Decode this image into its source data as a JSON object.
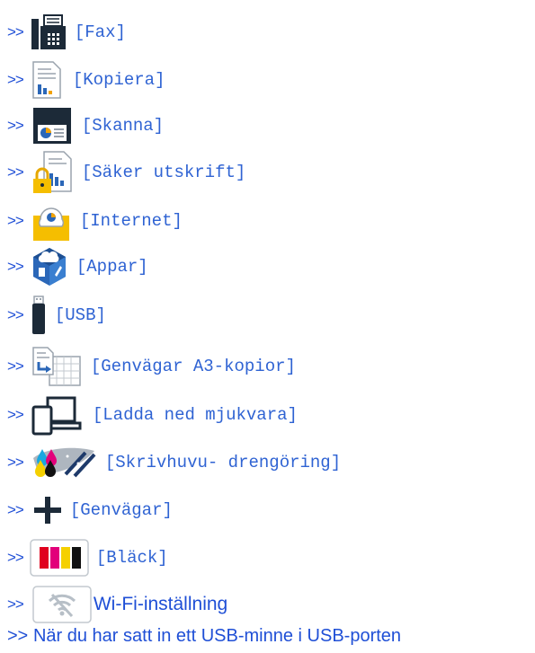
{
  "items": [
    {
      "arrow": ">>",
      "icon": "fax-icon",
      "label": "[Fax]"
    },
    {
      "arrow": ">>",
      "icon": "copy-icon",
      "label": "[Kopiera]"
    },
    {
      "arrow": ">>",
      "icon": "scan-icon",
      "label": "[Skanna]"
    },
    {
      "arrow": ">>",
      "icon": "secure-print-icon",
      "label": "[Säker utskrift]"
    },
    {
      "arrow": ">>",
      "icon": "internet-icon",
      "label": "[Internet]"
    },
    {
      "arrow": ">>",
      "icon": "apps-icon",
      "label": "[Appar]"
    },
    {
      "arrow": ">>",
      "icon": "usb-icon",
      "label": "[USB]"
    },
    {
      "arrow": ">>",
      "icon": "a3-copy-shortcuts-icon",
      "label": "[Genvägar A3-kopior]"
    },
    {
      "arrow": ">>",
      "icon": "download-software-icon",
      "label": "[Ladda ned mjukvara]"
    },
    {
      "arrow": ">>",
      "icon": "printhead-cleaning-icon",
      "label": "[Skrivhuvu- drengöring]"
    },
    {
      "arrow": ">>",
      "icon": "plus-icon",
      "label": "[Genvägar]"
    },
    {
      "arrow": ">>",
      "icon": "ink-icon",
      "label": "[Bläck]"
    },
    {
      "arrow": ">>",
      "icon": "wifi-off-icon",
      "label": "Wi-Fi-inställning"
    },
    {
      "arrow": ">>",
      "label": "När du har satt in ett USB-minne i USB-porten"
    }
  ],
  "colors": {
    "link": "#1f4fd6",
    "label": "#2f63d3"
  }
}
